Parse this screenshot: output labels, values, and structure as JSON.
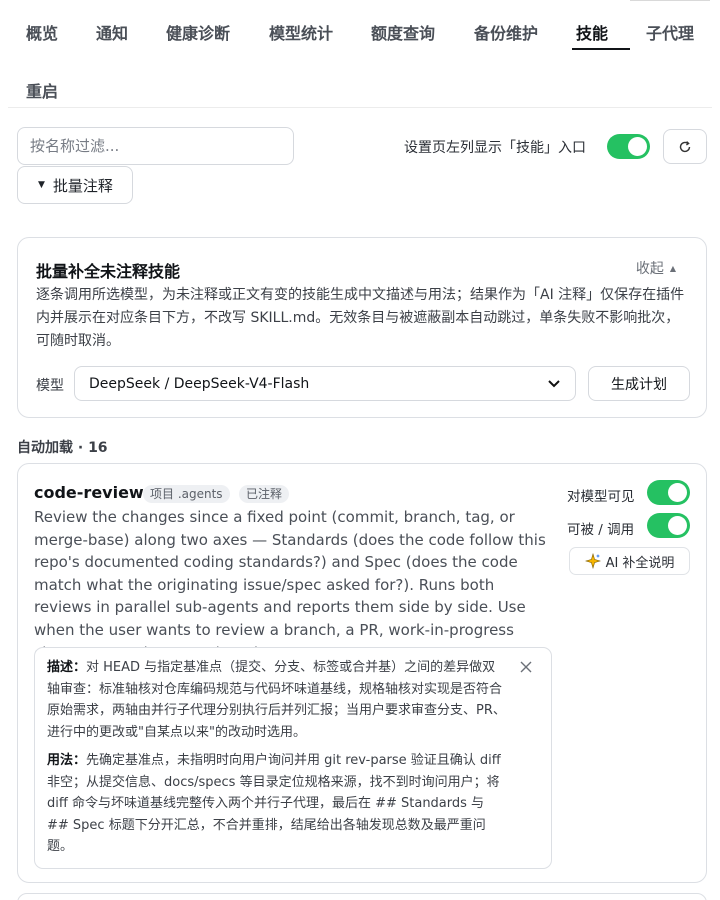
{
  "tabs": [
    {
      "label": "概览"
    },
    {
      "label": "通知"
    },
    {
      "label": "健康诊断"
    },
    {
      "label": "模型统计"
    },
    {
      "label": "额度查询"
    },
    {
      "label": "备份维护"
    },
    {
      "label": "技能",
      "active": true
    },
    {
      "label": "子代理"
    },
    {
      "label": "重启"
    }
  ],
  "toolbar": {
    "filter_placeholder": "按名称过滤...",
    "sidebar_toggle_label": "设置页左列显示「技能」入口",
    "sidebar_toggle_on": true,
    "refresh_icon": "refresh-icon",
    "batch_button_label": "批量注释"
  },
  "batch_panel": {
    "title": "批量补全未注释技能",
    "collapse_label": "收起",
    "description": "逐条调用所选模型，为未注释或正文有变的技能生成中文描述与用法；结果作为「AI 注释」仅保存在插件内并展示在对应条目下方，不改写 SKILL.md。无效条目与被遮蔽副本自动跳过，单条失败不影响批次，可随时取消。",
    "model_label": "模型",
    "model_selected": "DeepSeek / DeepSeek-V4-Flash",
    "generate_label": "生成计划"
  },
  "section_label": "自动加载 · 16",
  "skills": [
    {
      "name": "code-review",
      "badges": [
        "项目 .agents",
        "已注释"
      ],
      "description": "Review the changes since a fixed point (commit, branch, tag, or merge-base) along two axes — Standards (does the code follow this repo's documented coding standards?) and Spec (does the code match what the originating issue/spec asked for?). Runs both reviews in parallel sub-agents and reports them side by side. Use when the user wants to review a branch, a PR, work-in-progress changes, or asks to \"review since X\".",
      "visible_to_model_label": "对模型可见",
      "visible_to_model_on": true,
      "callable_label": "可被 / 调用",
      "callable_on": true,
      "ai_button_label": "AI 补全说明",
      "note": {
        "desc_title": "描述：",
        "desc_text": "对 HEAD 与指定基准点（提交、分支、标签或合并基）之间的差异做双轴审查：标准轴核对仓库编码规范与代码坏味道基线，规格轴核对实现是否符合原始需求，两轴由并行子代理分别执行后并列汇报；当用户要求审查分支、PR、进行中的更改或\"自某点以来\"的改动时选用。",
        "usage_title": "用法：",
        "usage_text": "先确定基准点，未指明时向用户询问并用 git rev-parse 验证且确认 diff 非空；从提交信息、docs/specs 等目录定位规格来源，找不到时询问用户；将 diff 命令与坏味道基线完整传入两个并行子代理，最后在 ## Standards 与 ## Spec 标题下分开汇总，不合并重排，结尾给出各轴发现总数及最严重问题。"
      }
    }
  ],
  "colors": {
    "accent_green": "#25c162",
    "border": "#dcdfe4",
    "text_primary": "#111418"
  }
}
